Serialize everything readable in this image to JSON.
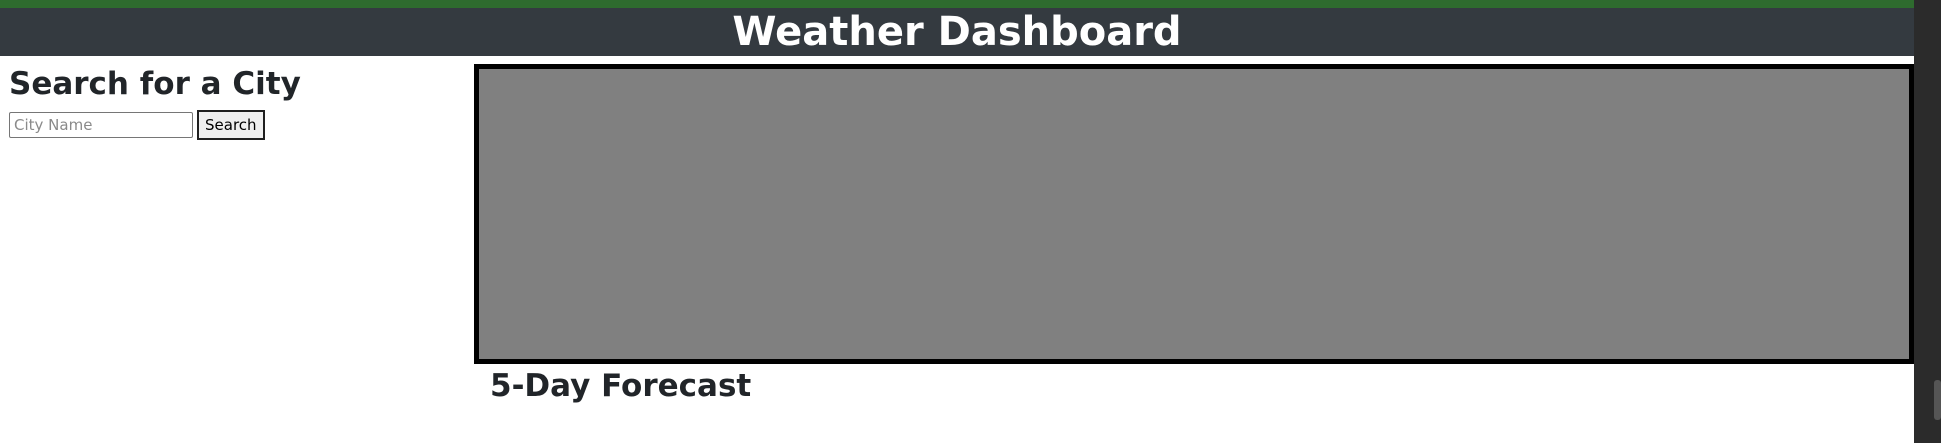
{
  "header": {
    "title": "Weather Dashboard"
  },
  "sidebar": {
    "heading": "Search for a City",
    "search": {
      "placeholder": "City Name",
      "value": "",
      "button_label": "Search"
    }
  },
  "main": {
    "forecast_heading": "5-Day Forecast"
  },
  "colors": {
    "header_bg": "#343a40",
    "top_strip": "#2e6b2e",
    "current_weather_bg": "#808080",
    "current_weather_border": "#000000"
  }
}
